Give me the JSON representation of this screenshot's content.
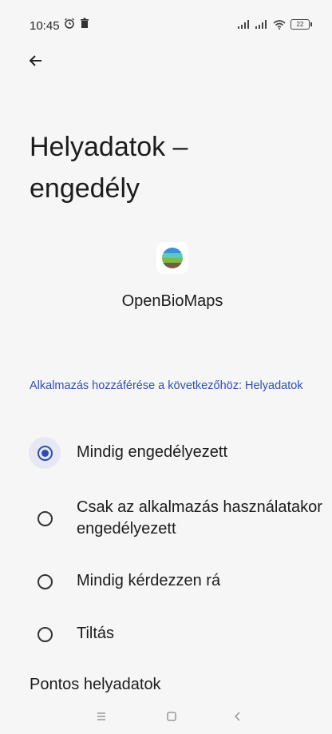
{
  "status_bar": {
    "time": "10:45",
    "battery": "22",
    "left_icons": [
      "alarm-icon",
      "trash-icon"
    ],
    "right_icons": [
      "signal-icon",
      "signal-icon",
      "wifi-icon",
      "battery-icon"
    ]
  },
  "header": {
    "back_icon": "back-arrow-icon",
    "title": "Helyadatok – engedély"
  },
  "app": {
    "name": "OpenBioMaps"
  },
  "access_label": "Alkalmazás hozzáférése a következőhöz: Helyadatok",
  "options": [
    {
      "label": "Mindig engedélyezett",
      "selected": true
    },
    {
      "label": "Csak az alkalmazás használatakor engedélyezett",
      "selected": false
    },
    {
      "label": "Mindig kérdezzen rá",
      "selected": false
    },
    {
      "label": "Tiltás",
      "selected": false
    }
  ],
  "precise_section_title": "Pontos helyadatok",
  "colors": {
    "accent": "#2f4fb0",
    "background": "#f6f6f6",
    "text": "#1c1c1c"
  },
  "nav_bar": [
    "menu-icon",
    "home-icon",
    "back-icon"
  ]
}
